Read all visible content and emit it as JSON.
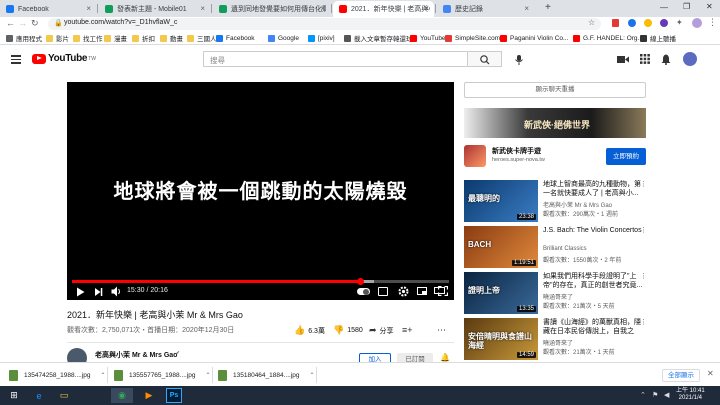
{
  "browser": {
    "tabs": [
      {
        "title": "Facebook",
        "icon": "facebook-icon",
        "color": "#1877f2",
        "active": false
      },
      {
        "title": "發表新主題 - Mobile01",
        "icon": "mobile01-icon",
        "color": "#0f9d58",
        "active": false
      },
      {
        "title": "遺到同地發覺要如何用傳台化剩",
        "icon": "mobile01-icon",
        "color": "#0f9d58",
        "active": false
      },
      {
        "title": "2021．新年快樂 | 老高與小茉 M",
        "icon": "youtube-icon",
        "color": "#ff0000",
        "active": true
      },
      {
        "title": "歷史記錄",
        "icon": "history-icon",
        "color": "#4285f4",
        "active": false
      }
    ],
    "new_tab": "+",
    "url": "youtube.com/watch?v=_D1hvflaW_c",
    "bookmarks": [
      {
        "label": "應用程式",
        "icon": "apps-icon",
        "color": "#5f6368"
      },
      {
        "label": "影片",
        "icon": "folder-icon",
        "color": "#f2c94c"
      },
      {
        "label": "找工作",
        "icon": "folder-icon",
        "color": "#f2c94c"
      },
      {
        "label": "漫畫",
        "icon": "folder-icon",
        "color": "#f2c94c"
      },
      {
        "label": "折扣",
        "icon": "folder-icon",
        "color": "#f2c94c"
      },
      {
        "label": "動畫",
        "icon": "folder-icon",
        "color": "#f2c94c"
      },
      {
        "label": "三國人",
        "icon": "folder-icon",
        "color": "#f2c94c"
      },
      {
        "label": "Facebook",
        "icon": "facebook-icon",
        "color": "#1877f2"
      },
      {
        "label": "Google",
        "icon": "google-icon",
        "color": "#4285f4"
      },
      {
        "label": "[pixiv]",
        "icon": "pixiv-icon",
        "color": "#0096fa"
      },
      {
        "label": "載入文章暫存韓還球",
        "icon": "page-icon",
        "color": "#555555"
      },
      {
        "label": "YouTube",
        "icon": "youtube-icon",
        "color": "#ff0000"
      },
      {
        "label": "SimpleSite.com",
        "icon": "simplesite-icon",
        "color": "#e53935"
      },
      {
        "label": "Paganini Violin Co...",
        "icon": "youtube-icon",
        "color": "#ff0000"
      },
      {
        "label": "G.F. HANDEL: Org...",
        "icon": "youtube-icon",
        "color": "#ff0000"
      },
      {
        "label": "線上聽播",
        "icon": "radio-icon",
        "color": "#333333"
      }
    ]
  },
  "youtube": {
    "logo": "YouTube",
    "region": "TW",
    "search_placeholder": "搜尋",
    "player": {
      "caption": "地球將會被一個跳動的太陽燒毀",
      "current_time": "15:30",
      "duration": "20:16",
      "time_display": "15:30 / 20:16",
      "progress": 0.765,
      "buffered": 0.8
    },
    "video": {
      "title": "2021．新年快樂 | 老高與小茉 Mr & Mrs Gao",
      "views_date": "觀看次數：2,750,071次・首播日期：2020年12月30日",
      "likes": "6.3萬",
      "dislikes": "1580",
      "share": "分享",
      "channel": "老高與小茉 Mr & Mrs Gao",
      "join": "加入",
      "subscribe": "已訂閱"
    },
    "sidebar": {
      "chat_replay": "顯示聊天重播",
      "ad": {
        "banner_text": "新武俠·絕佛世界",
        "title": "新武俠卡牌手遊",
        "domain": "heroes.super-nova.tw",
        "cta": "立即預約"
      },
      "recommendations": [
        {
          "title": "地球上智商最高的九種動物，第一名就快要成人了 | 老高與小...",
          "thumb_text": "最聰明的",
          "duration": "23:38",
          "channel": "老高與小茉 Mr & Mrs Gao",
          "meta": "觀看次數：290萬次・1 週前",
          "colors": [
            "#0b3a6e",
            "#3b7dc4"
          ]
        },
        {
          "title": "J.S. Bach: The Violin Concertos",
          "thumb_text": "BACH",
          "duration": "1:19:51",
          "channel": "Brilliant Classics",
          "meta": "觀看次數：1550萬次・2 年前",
          "colors": [
            "#8a3b12",
            "#e08a3c"
          ]
        },
        {
          "title": "如果我們用科學手段證明了\"上帝\"的存在，真正的創世者究竟...",
          "thumb_text": "證明上帝",
          "duration": "13:35",
          "channel": "曉涵哥來了",
          "meta": "觀看次數：21萬次・5 天前",
          "colors": [
            "#0a2440",
            "#3a6a9a"
          ]
        },
        {
          "title": "書讀《山海經》的萬獸真相，隱藏在日本民俗傳說上，自我之子...",
          "thumb_text": "安倍晴明與食譜山海經",
          "duration": "14:59",
          "channel": "曉涵哥來了",
          "meta": "觀看次數：21萬次・1 天前",
          "colors": [
            "#5a3a10",
            "#c99a3a"
          ]
        }
      ]
    }
  },
  "downloads": {
    "items": [
      {
        "name": "135474258_1988....jpg",
        "icon": "image-file-icon"
      },
      {
        "name": "135557765_1988....jpg",
        "icon": "image-file-icon"
      },
      {
        "name": "135180464_1884....jpg",
        "icon": "image-file-icon"
      }
    ],
    "show_all": "全部顯示"
  },
  "taskbar": {
    "apps": [
      {
        "icon": "windows-start-icon",
        "color": "#ffffff"
      },
      {
        "icon": "ie-icon",
        "color": "#1e90ff"
      },
      {
        "icon": "explorer-icon",
        "color": "#f2c94c"
      },
      {
        "icon": "chrome-icon",
        "color": "#34a853"
      },
      {
        "icon": "media-player-icon",
        "color": "#ff8c00"
      },
      {
        "icon": "photoshop-icon",
        "color": "#31a8ff"
      }
    ],
    "photoshop_label": "Ps",
    "time": "上午 10:41",
    "date": "2021/1/4"
  }
}
